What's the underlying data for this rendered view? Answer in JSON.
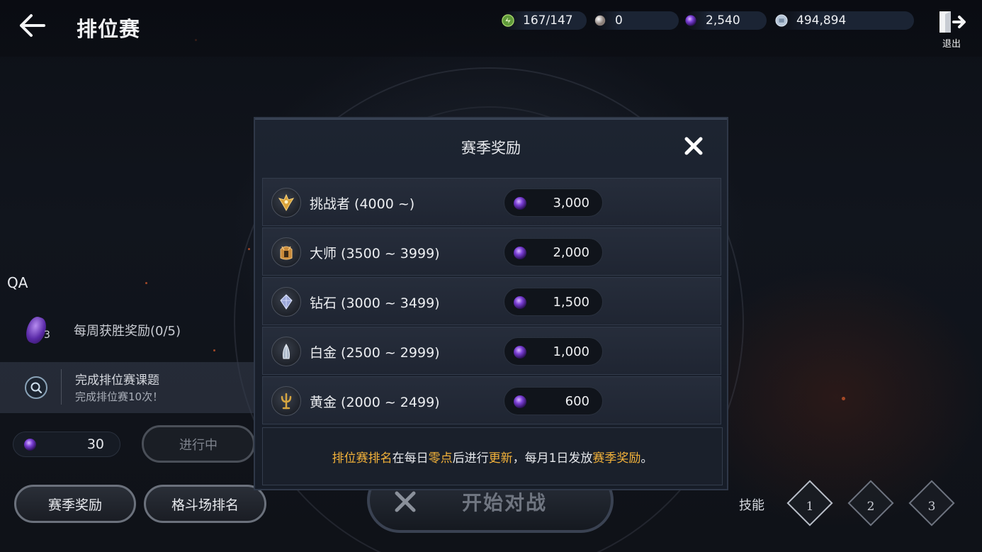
{
  "header": {
    "title": "排位赛",
    "resources": [
      {
        "icon": "stamina-icon",
        "value": "167/147",
        "color": "#7fbf4d"
      },
      {
        "icon": "pearl-icon",
        "value": "0",
        "color": "#d8d4d0"
      },
      {
        "icon": "purple-orb-icon",
        "value": "2,540",
        "color": "#7b3fd6"
      },
      {
        "icon": "silver-coin-icon",
        "value": "494,894",
        "color": "#b7c6d8"
      }
    ],
    "exit_label": "退出"
  },
  "left_panel": {
    "qa_label": "QA",
    "weekly_reward": {
      "gem_count": "3",
      "text": "每周获胜奖励(0/5)"
    },
    "quest": {
      "title": "完成排位赛课题",
      "subtitle": "完成排位赛10次！",
      "reward_value": "30",
      "status_label": "进行中"
    },
    "buttons": {
      "season_reward": "赛季奖励",
      "arena_ranking": "格斗场排名"
    }
  },
  "start_battle_label": "开始对战",
  "skills": {
    "label": "技能",
    "slots": [
      "1",
      "2",
      "3"
    ]
  },
  "modal": {
    "title": "赛季奖励",
    "tiers": [
      {
        "name": "挑战者 (4000 ~)",
        "reward": "3,000",
        "icon": "challenger-crest-icon",
        "color": "#d9a23a"
      },
      {
        "name": "大师 (3500 ~ 3999)",
        "reward": "2,000",
        "icon": "master-crest-icon",
        "color": "#c98a3a"
      },
      {
        "name": "钻石 (3000 ~ 3499)",
        "reward": "1,500",
        "icon": "diamond-crest-icon",
        "color": "#9aa6d8"
      },
      {
        "name": "白金 (2500 ~ 2999)",
        "reward": "1,000",
        "icon": "platinum-crest-icon",
        "color": "#aab7c8"
      },
      {
        "name": "黄金 (2000 ~ 2499)",
        "reward": "600",
        "icon": "gold-crest-icon",
        "color": "#d7a640"
      }
    ],
    "note": {
      "p1": "排位赛排名",
      "p2": "在每日",
      "p3": "零点",
      "p4": "后进行",
      "p5": "更新",
      "p6": "，每月1日发放",
      "p7": "赛季奖励",
      "p8": "。"
    },
    "highlight_color": "#f3b23a"
  }
}
